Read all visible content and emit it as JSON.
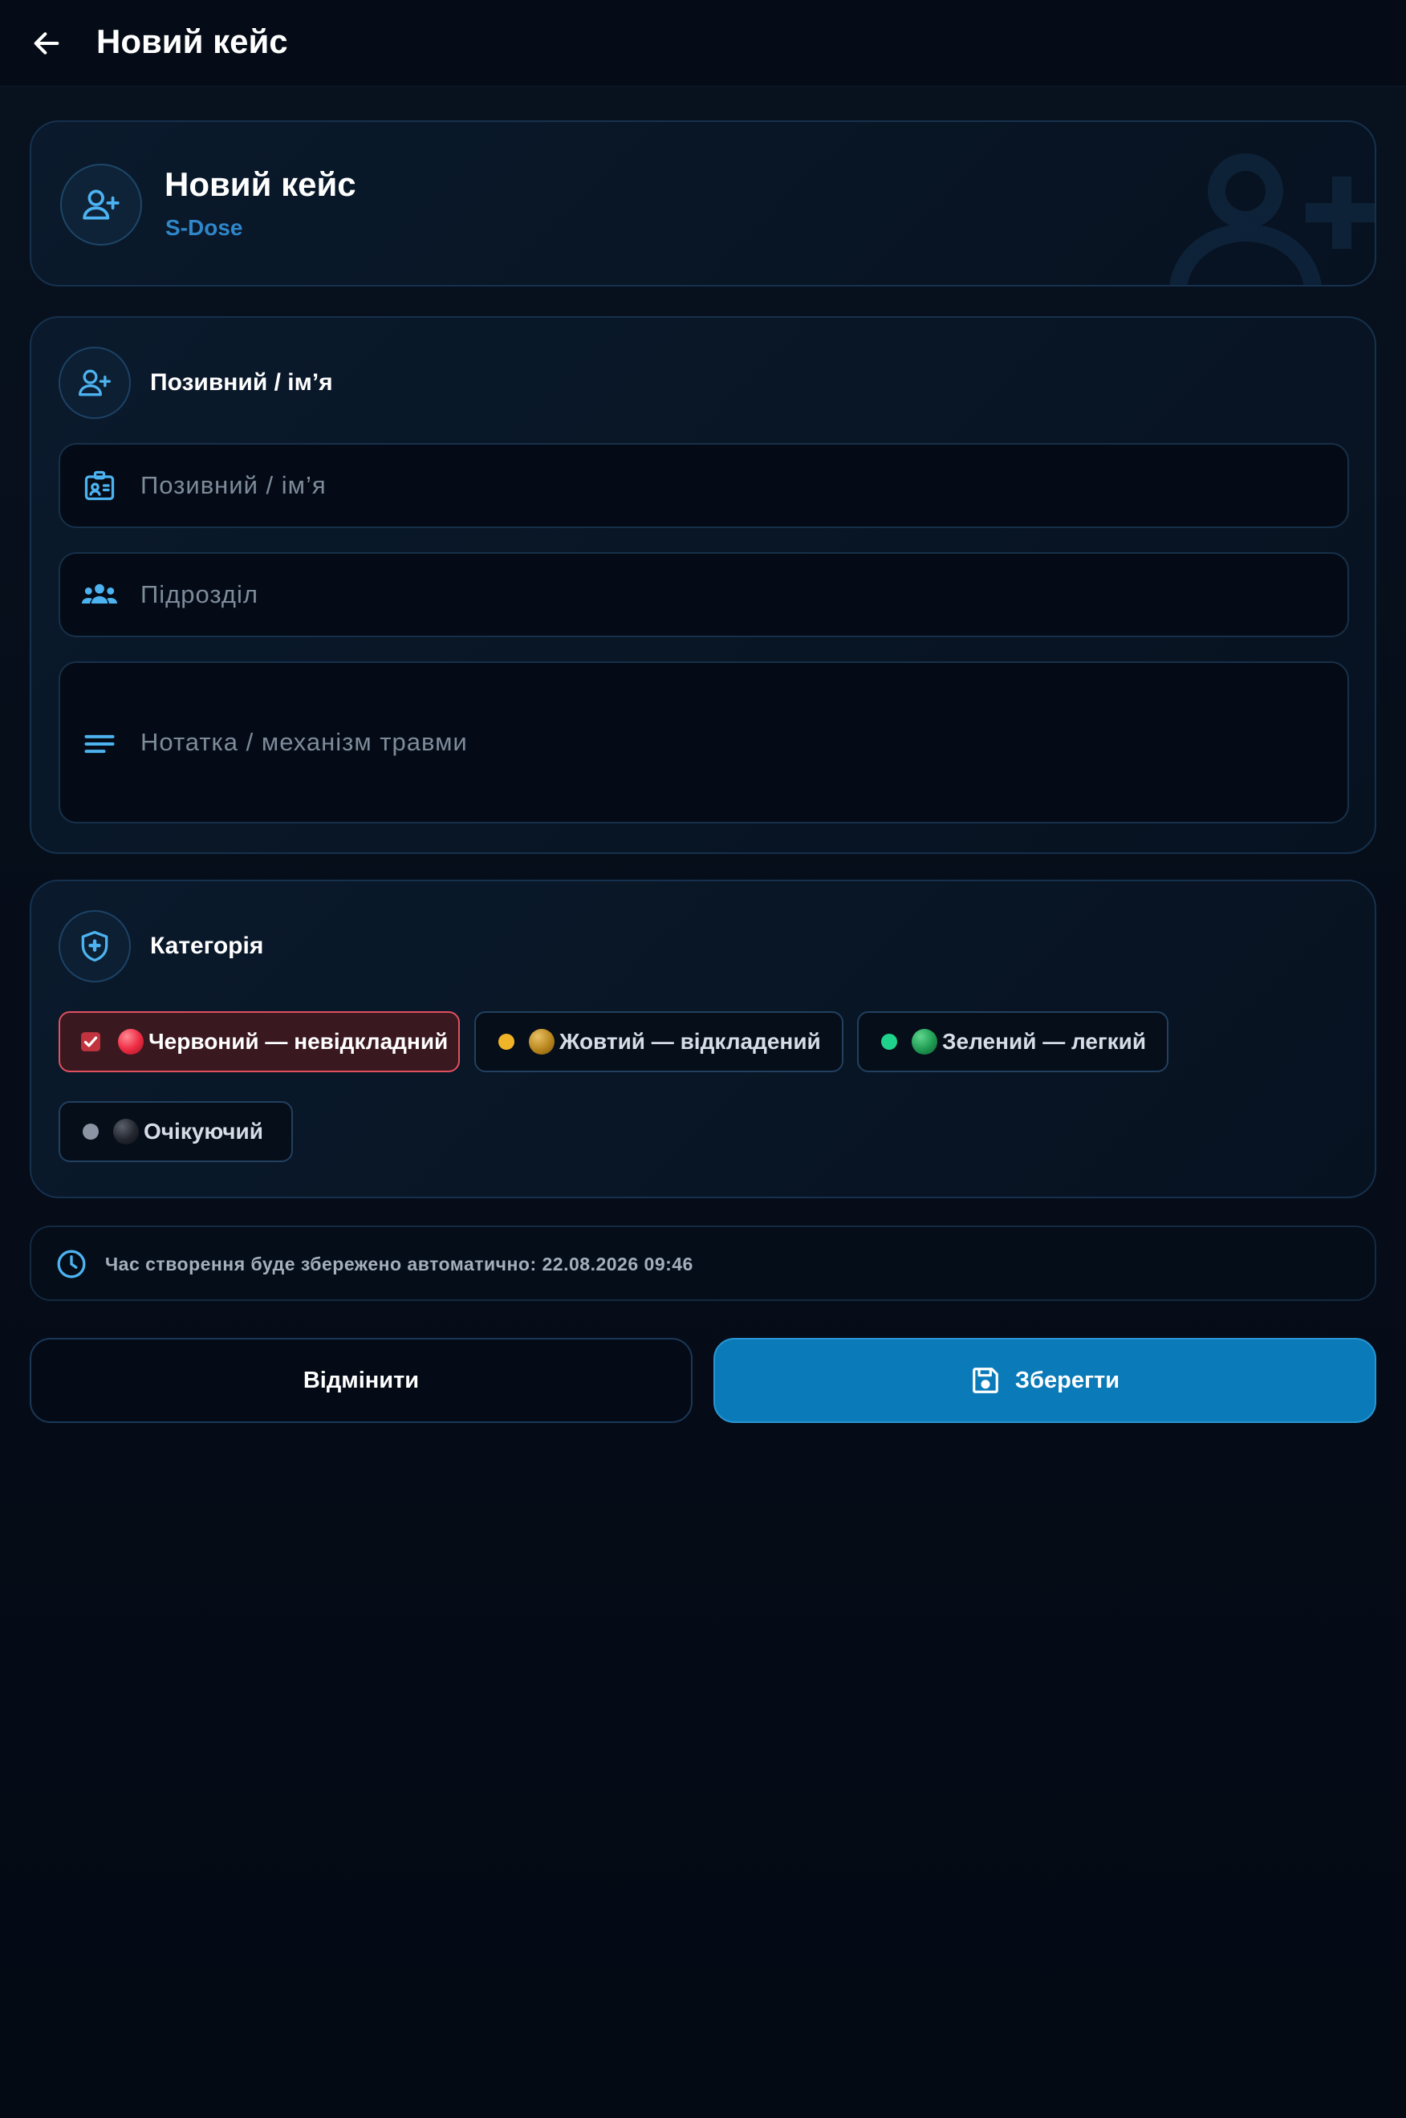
{
  "topbar": {
    "title": "Новий кейс"
  },
  "hero": {
    "title": "Новий кейс",
    "subtitle": "S-Dose"
  },
  "form": {
    "section_title": "Позивний / ім’я",
    "fields": {
      "callsign_placeholder": "Позивний / ім’я",
      "callsign_value": "",
      "unit_placeholder": "Підрозділ",
      "unit_value": "",
      "note_placeholder": "Нотатка / механізм травми",
      "note_value": ""
    }
  },
  "category": {
    "section_title": "Категорія",
    "selected": "red",
    "options": [
      {
        "id": "red",
        "label": "Червоний — невідкладний",
        "color": "#e8424f"
      },
      {
        "id": "yellow",
        "label": "Жовтий — відкладений",
        "color": "#f0b429"
      },
      {
        "id": "green",
        "label": "Зелений — легкий",
        "color": "#1fd48a"
      },
      {
        "id": "pending",
        "label": "Очікуючий",
        "color": "#8a94a3"
      }
    ]
  },
  "info": {
    "text": "Час створення буде збережено автоматично: 22.08.2026 09:46"
  },
  "actions": {
    "cancel_label": "Відмінити",
    "save_label": "Зберегти"
  },
  "colors": {
    "accent": "#0a7ab8",
    "icon_blue": "#4db3f0",
    "background": "#060d19"
  },
  "icons": {
    "back": "arrow-left-icon",
    "hero": "user-plus-icon",
    "callsign": "id-badge-icon",
    "unit": "group-icon",
    "note": "lines-icon",
    "category": "shield-plus-icon",
    "info": "clock-icon",
    "save": "floppy-disk-icon"
  }
}
